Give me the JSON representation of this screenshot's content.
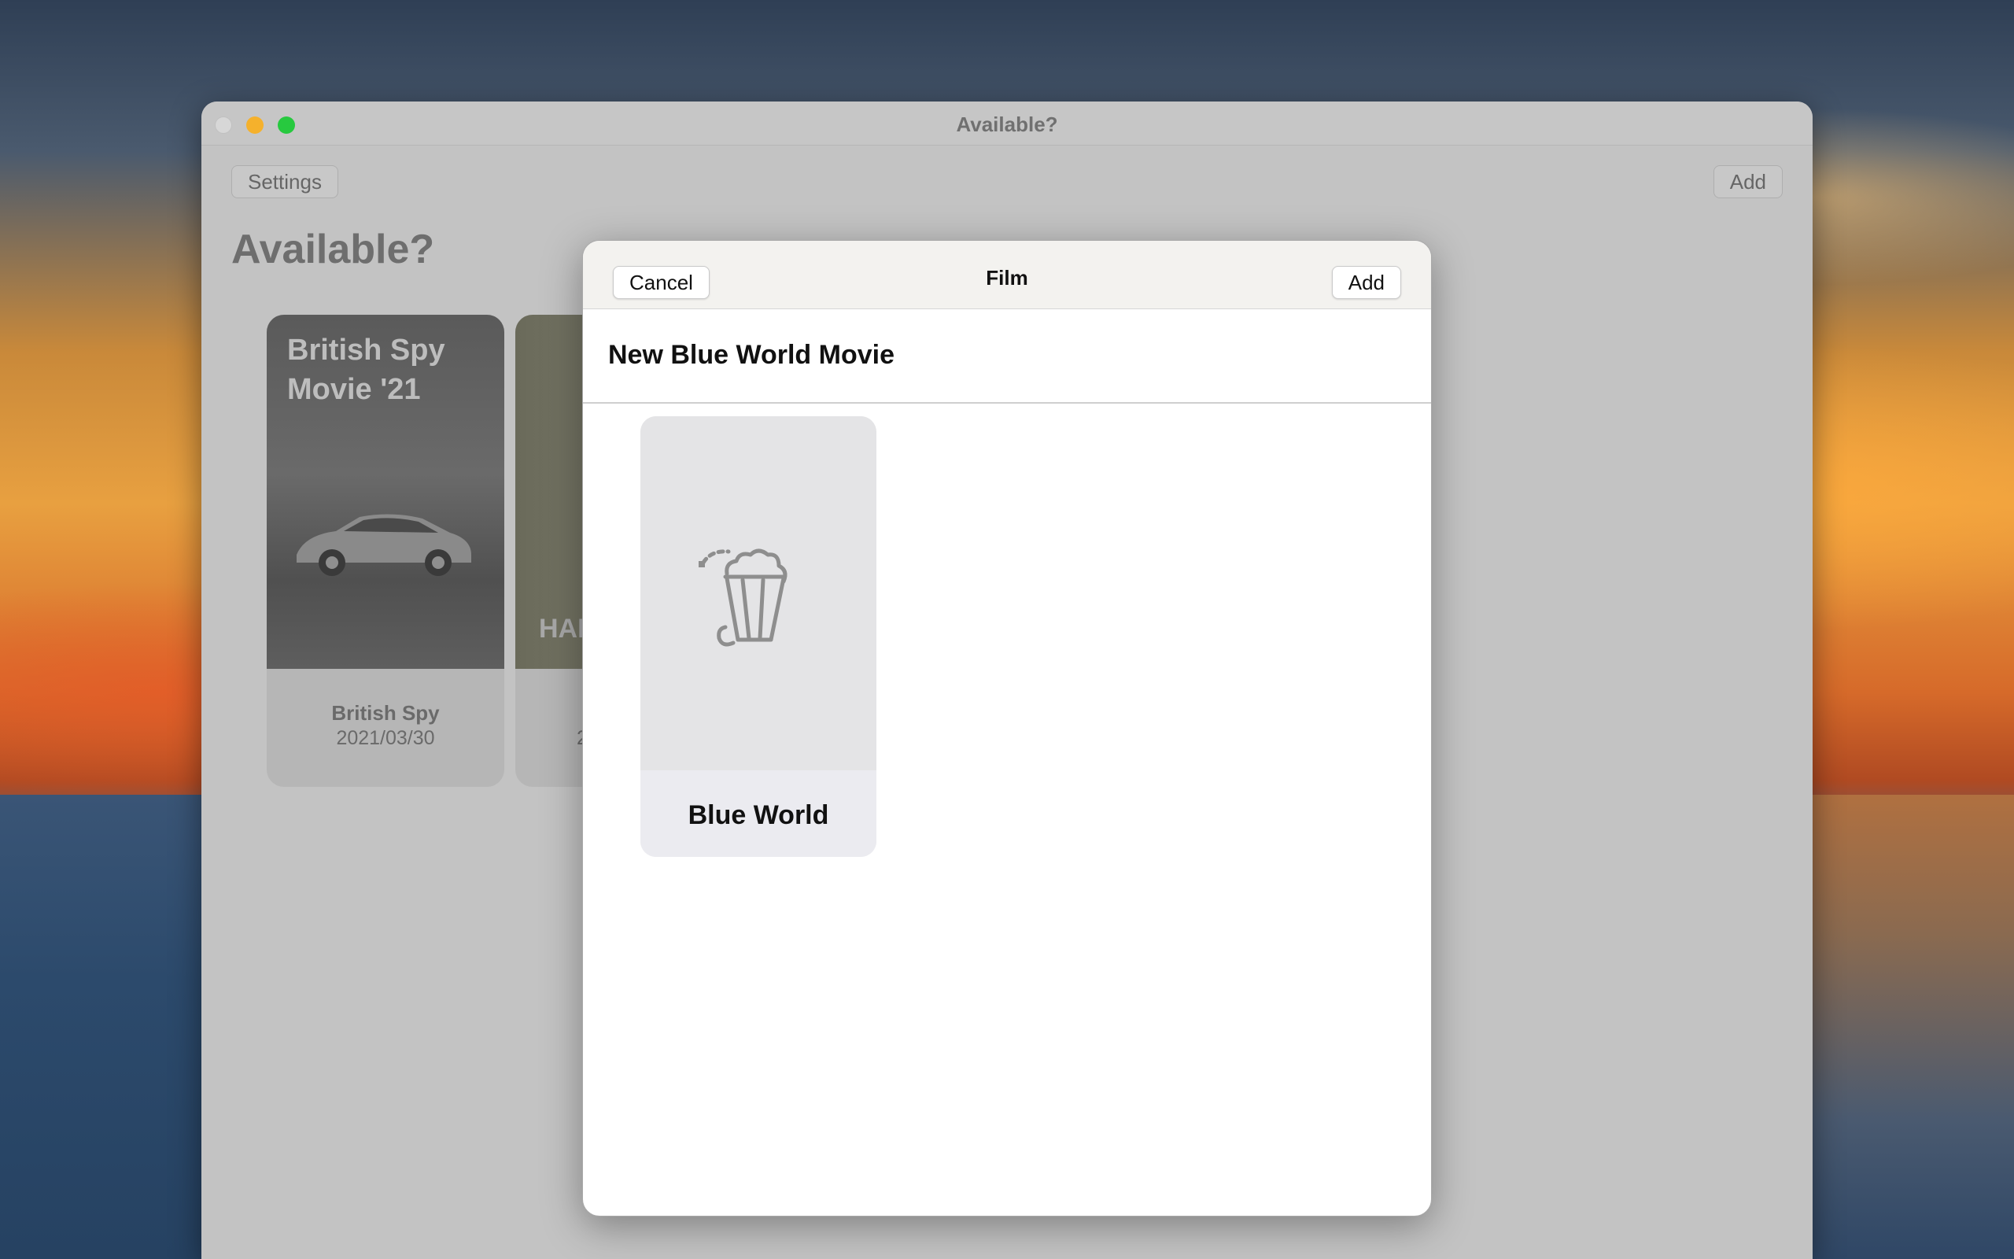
{
  "window": {
    "title": "Available?",
    "toolbar": {
      "settings_label": "Settings",
      "add_label": "Add"
    },
    "heading": "Available?",
    "movies": [
      {
        "poster_text": "British Spy Movie '21",
        "name": "British Spy",
        "date": "2021/03/30"
      },
      {
        "poster_text": "HAN",
        "date": "2"
      }
    ]
  },
  "sheet": {
    "title": "Film",
    "cancel_label": "Cancel",
    "add_label": "Add",
    "name_value": "New Blue World Movie",
    "genre_cards": [
      {
        "label": "Blue World",
        "icon": "popcorn-icon"
      }
    ]
  },
  "colors": {
    "traffic_close": "#d7d7d7",
    "traffic_minimize": "#f5b12c",
    "traffic_zoom": "#27c93f"
  }
}
